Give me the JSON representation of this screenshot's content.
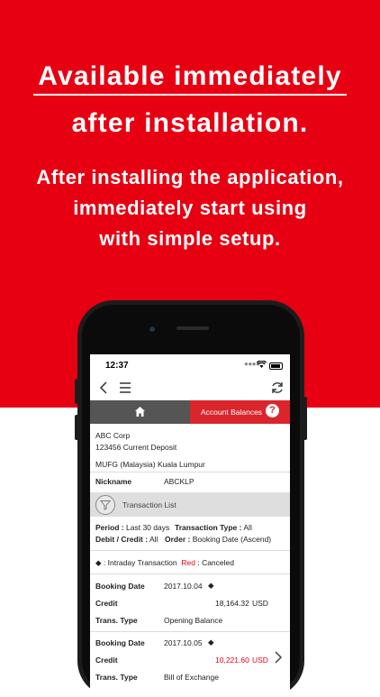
{
  "promo": {
    "headline_line1": "Available immediately",
    "headline_line2": "after installation.",
    "sub_line1": "After installing the application,",
    "sub_line2": "immediately start using",
    "sub_line3": "with simple setup."
  },
  "status_bar": {
    "time": "12:37"
  },
  "tabs": {
    "account_balances": "Account Balances",
    "help": "?"
  },
  "account": {
    "company": "ABC Corp",
    "account_line": "123456 Current Deposit",
    "bank": "MUFG (Malaysia) Kuala Lumpur",
    "nickname_label": "Nickname",
    "nickname_value": "ABCKLP"
  },
  "transaction_list": {
    "title": "Transaction List",
    "period_label": "Period :",
    "period_value": "Last 30 days",
    "type_label": "Transaction Type :",
    "type_value": "All",
    "dc_label": "Debit / Credit :",
    "dc_value": "All",
    "order_label": "Order :",
    "order_value": "Booking Date (Ascend)",
    "legend_intraday": "◆ : Intraday Transaction",
    "legend_red": "Red",
    "legend_canceled": ": Canceled"
  },
  "transactions": [
    {
      "booking_label": "Booking Date",
      "booking_date": "2017.10.04",
      "marker": "◆",
      "dc": "Credit",
      "amount": "18,164.32",
      "currency": "USD",
      "type_label": "Trans. Type",
      "type": "Opening Balance"
    },
    {
      "booking_label": "Booking Date",
      "booking_date": "2017.10.05",
      "marker": "◆",
      "dc": "Credit",
      "amount": "10,221.60",
      "currency": "USD",
      "type_label": "Trans. Type",
      "type": "Bill of Exchange"
    }
  ],
  "colors": {
    "brand_red": "#e60012",
    "tab_red": "#d9252b",
    "tab_dark": "#555555"
  }
}
